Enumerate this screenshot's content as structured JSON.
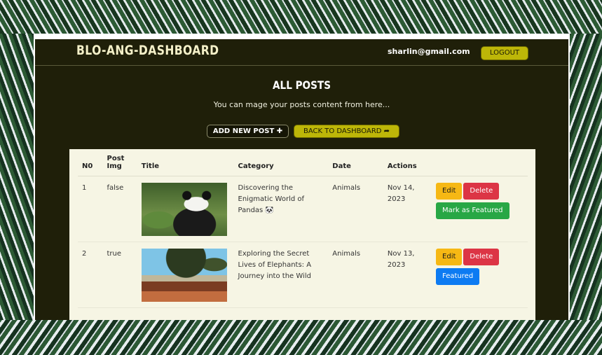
{
  "navbar": {
    "brand": "BLO-ANG-DASHBOARD",
    "email": "sharlin@gmail.com",
    "logout_label": "LOGOUT"
  },
  "page": {
    "title": "ALL POSTS",
    "subtitle": "You can mage your posts content from here...",
    "add_button": "ADD NEW POST ✚",
    "back_button": "BACK TO DASHBOARD ➦"
  },
  "table": {
    "headers": [
      "N0",
      "Post Img",
      "Title",
      "Category",
      "Date",
      "Actions"
    ],
    "rows": [
      {
        "no": "1",
        "post_img": "false",
        "title": "Discovering the Enigmatic World of Pandas 🐼",
        "category": "Animals",
        "date": "Nov 14, 2023",
        "edit": "Edit",
        "delete": "Delete",
        "feature": "Mark as Featured",
        "image": "panda-photo"
      },
      {
        "no": "2",
        "post_img": "true",
        "title": "Exploring the Secret Lives of Elephants: A Journey into the Wild",
        "category": "Animals",
        "date": "Nov 13, 2023",
        "edit": "Edit",
        "delete": "Delete",
        "feature": "Featured",
        "image": "elephants-photo"
      }
    ]
  },
  "colors": {
    "background": "#1f1f09",
    "accent": "#bdb608",
    "table_bg": "#f6f5e4",
    "edit": "#f6b814",
    "delete": "#dc3545",
    "featured_green": "#28a745",
    "featured_blue": "#0d7bf2"
  }
}
